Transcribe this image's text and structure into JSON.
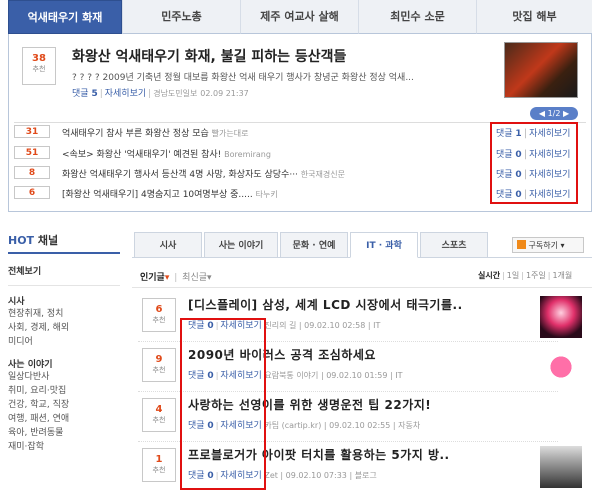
{
  "top_tabs": [
    "억새태우기 화재",
    "민주노총",
    "제주 여교사 살해",
    "최민수 소문",
    "맛집 해부"
  ],
  "featured": {
    "votes": "38",
    "vote_label": "추천",
    "title": "화왕산 억새태우기 화재, 불길 피하는 등산객들",
    "summary": "? ? ? ? 2009년 기축년 정월 대보름 화왕산 억새 태우기 행사가 창녕군 화왕산 정상 억새...",
    "comments_label": "댓글",
    "comments": "5",
    "detail": "자세히보기",
    "source": "경남도민일보",
    "date": "02.09 21:37"
  },
  "pager": "1/2",
  "related": [
    {
      "votes": "31",
      "title": "억새태우기 참사 부른 화왕산 정상 모습",
      "source": "빨가는대로",
      "comments": "1"
    },
    {
      "votes": "51",
      "title": "<속보> 화왕산 '억새태우기' 예견된 참사!",
      "source": "Boremirang",
      "comments": "0"
    },
    {
      "votes": "8",
      "title": "화왕산 억새태우기 행사서 등산객 4명 사망, 화상자도 상당수···",
      "source": "한국재경신문",
      "comments": "0"
    },
    {
      "votes": "6",
      "title": "[화왕산 억새태우기] 4명숨지고 10여명부상 중.....",
      "source": "타누키",
      "comments": "0"
    }
  ],
  "left": {
    "hot": "HOT",
    "channel": "채널",
    "all": "전체보기",
    "sections": [
      {
        "title": "시사",
        "items": [
          "현장취재, 정치",
          "사회, 경제, 해외",
          "미디어"
        ]
      },
      {
        "title": "사는 이야기",
        "items": [
          "일상다반사",
          "취미, 요리·맛집",
          "건강, 학교, 직장",
          "여행, 패션, 연애",
          "육아, 반려동물",
          "재미·잡학"
        ]
      }
    ]
  },
  "cat_tabs": [
    "시사",
    "사는 이야기",
    "문화 · 연예",
    "IT · 과학",
    "스포츠"
  ],
  "subscribe": "구독하기",
  "sort": {
    "popular": "인기글",
    "latest": "최신글"
  },
  "range": {
    "label": "실시간",
    "day1": "1일",
    "week": "1주일",
    "month": "1개월"
  },
  "articles": [
    {
      "votes": "6",
      "title": "[디스플레이] 삼성, 세계 LCD 시장에서 태극기를..",
      "comments": "0",
      "source": "진리의 길",
      "date": "09.02.10 02:58",
      "cat": "IT"
    },
    {
      "votes": "9",
      "title": "2090년 바이러스 공격 조심하세요",
      "comments": "0",
      "source": "요람북통 이야기",
      "date": "09.02.10 01:59",
      "cat": "IT"
    },
    {
      "votes": "4",
      "title": "사랑하는 선영이를 위한 생명운전 팁 22가지!",
      "comments": "0",
      "source": "카팁 (cartip.kr)",
      "date": "09.02.10 02:55",
      "cat": "자동차"
    },
    {
      "votes": "1",
      "title": "프로블로거가 아이팟 터치를 활용하는 5가지 방..",
      "comments": "0",
      "source": "Zet",
      "date": "09.02.10 07:33",
      "cat": "블로그"
    }
  ],
  "colors": {
    "accent": "#3a5fa8",
    "highlight": "#e01010",
    "vote": "#e04a1a"
  }
}
